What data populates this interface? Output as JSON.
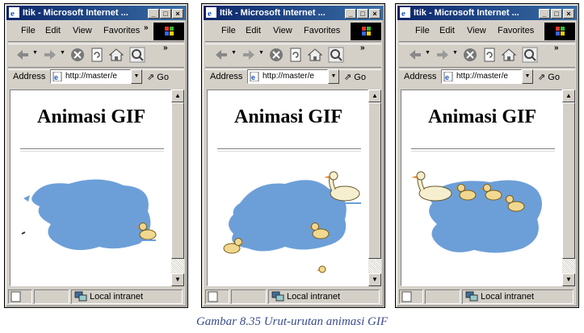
{
  "windows": [
    {
      "title": "Itik - Microsoft Internet ...",
      "menu": [
        "File",
        "Edit",
        "View",
        "Favorites"
      ],
      "address_label": "Address",
      "address_value": "http://master/e",
      "go_label": "Go",
      "heading": "Animasi GIF",
      "status_text": "Local intranet"
    },
    {
      "title": "Itik - Microsoft Internet ...",
      "menu": [
        "File",
        "Edit",
        "View",
        "Favorites"
      ],
      "address_label": "Address",
      "address_value": "http://master/e",
      "go_label": "Go",
      "heading": "Animasi GIF",
      "status_text": "Local intranet"
    },
    {
      "title": "Itik - Microsoft Internet ...",
      "menu": [
        "File",
        "Edit",
        "View",
        "Favorites"
      ],
      "address_label": "Address",
      "address_value": "http://master/e",
      "go_label": "Go",
      "heading": "Animasi GIF",
      "status_text": "Local intranet"
    }
  ],
  "caption": "Gambar 8.35 Urut-urutan animasi GIF",
  "colors": {
    "title_gradient_start": "#0a246a",
    "title_gradient_end": "#3a6ea5",
    "pond": "#6c9fd8",
    "chrome": "#d4d0c8",
    "caption": "#3a4b8f"
  },
  "icons": [
    "back-arrow-icon",
    "forward-arrow-icon",
    "stop-icon",
    "refresh-icon",
    "home-icon",
    "search-icon",
    "windows-logo-icon",
    "ie-page-icon",
    "go-icon",
    "local-intranet-icon"
  ]
}
